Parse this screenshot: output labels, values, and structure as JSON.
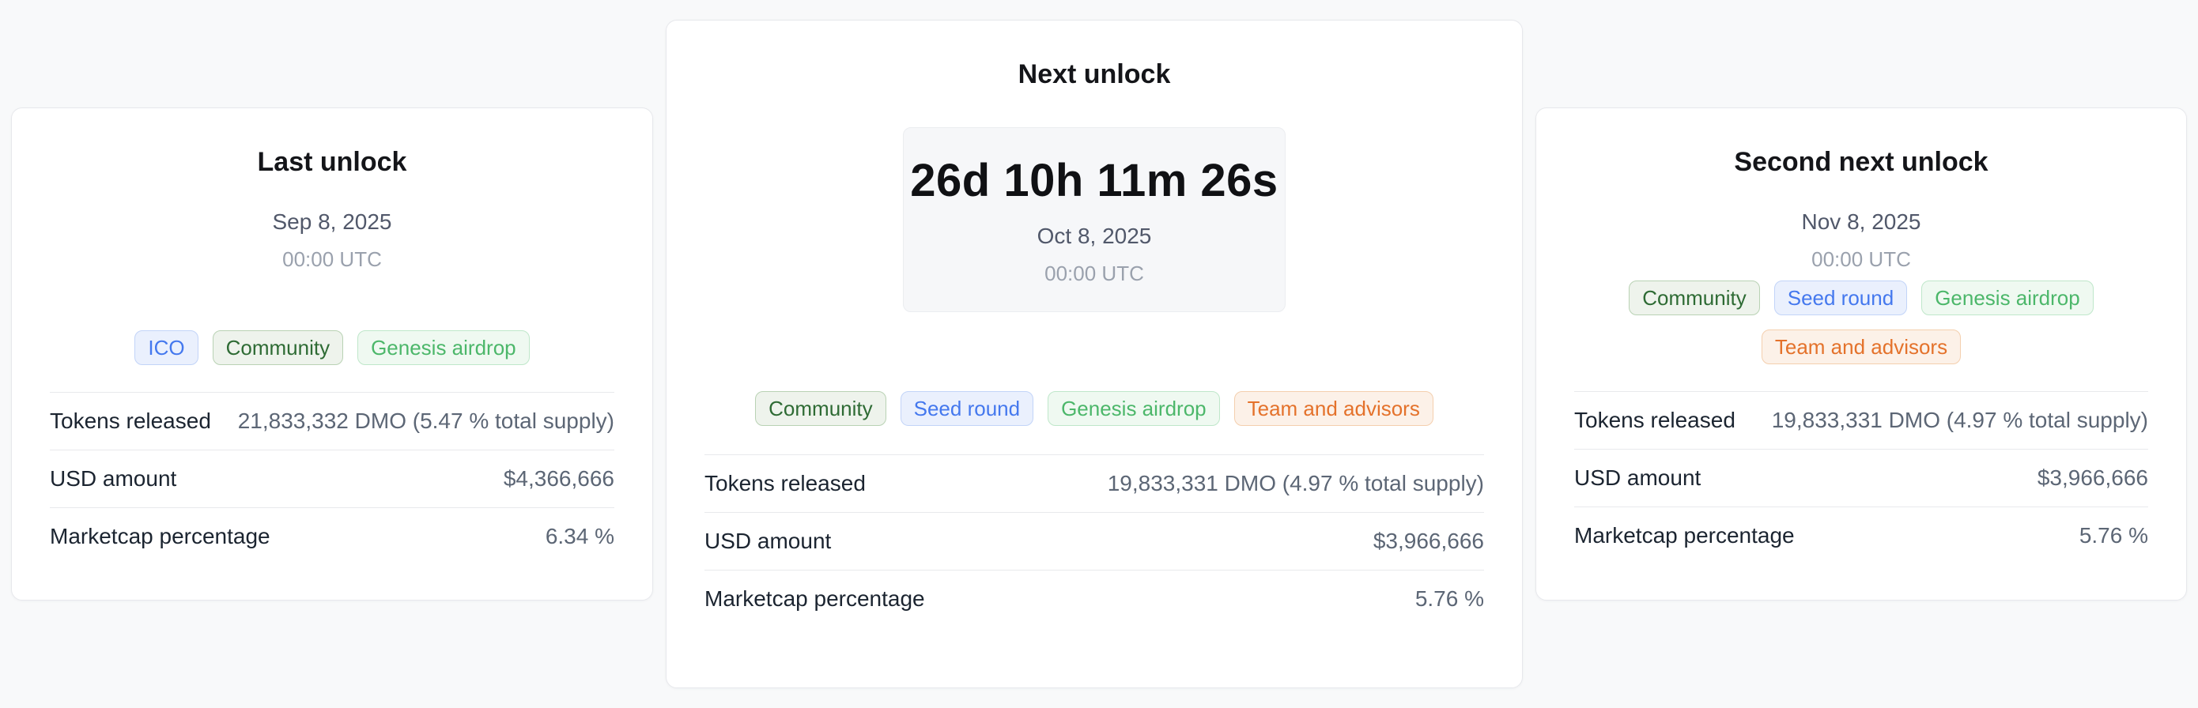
{
  "colors": {
    "page_background": "#f8f9fa",
    "card_background": "#ffffff",
    "tag_blue": "#4478ee",
    "tag_green_dark": "#2e6b34",
    "tag_green": "#4cb76a",
    "tag_orange": "#e4722b"
  },
  "cards": [
    {
      "title": "Last unlock",
      "date": "Sep 8, 2025",
      "time": "00:00 UTC",
      "tags": [
        {
          "label": "ICO",
          "color": "blue"
        },
        {
          "label": "Community",
          "color": "green-dark"
        },
        {
          "label": "Genesis airdrop",
          "color": "green"
        }
      ],
      "rows": [
        {
          "label": "Tokens released",
          "value": "21,833,332 DMO (5.47 % total supply)"
        },
        {
          "label": "USD amount",
          "value": "$4,366,666"
        },
        {
          "label": "Marketcap percentage",
          "value": "6.34 %"
        }
      ]
    },
    {
      "title": "Next unlock",
      "countdown": "26d 10h 11m 26s",
      "date": "Oct 8, 2025",
      "time": "00:00 UTC",
      "tags": [
        {
          "label": "Community",
          "color": "green-dark"
        },
        {
          "label": "Seed round",
          "color": "blue"
        },
        {
          "label": "Genesis airdrop",
          "color": "green"
        },
        {
          "label": "Team and advisors",
          "color": "orange"
        }
      ],
      "rows": [
        {
          "label": "Tokens released",
          "value": "19,833,331 DMO (4.97 % total supply)"
        },
        {
          "label": "USD amount",
          "value": "$3,966,666"
        },
        {
          "label": "Marketcap percentage",
          "value": "5.76 %"
        }
      ]
    },
    {
      "title": "Second next unlock",
      "date": "Nov 8, 2025",
      "time": "00:00 UTC",
      "tags": [
        {
          "label": "Community",
          "color": "green-dark"
        },
        {
          "label": "Seed round",
          "color": "blue"
        },
        {
          "label": "Genesis airdrop",
          "color": "green"
        },
        {
          "label": "Team and advisors",
          "color": "orange"
        }
      ],
      "rows": [
        {
          "label": "Tokens released",
          "value": "19,833,331 DMO (4.97 % total supply)"
        },
        {
          "label": "USD amount",
          "value": "$3,966,666"
        },
        {
          "label": "Marketcap percentage",
          "value": "5.76 %"
        }
      ]
    }
  ]
}
